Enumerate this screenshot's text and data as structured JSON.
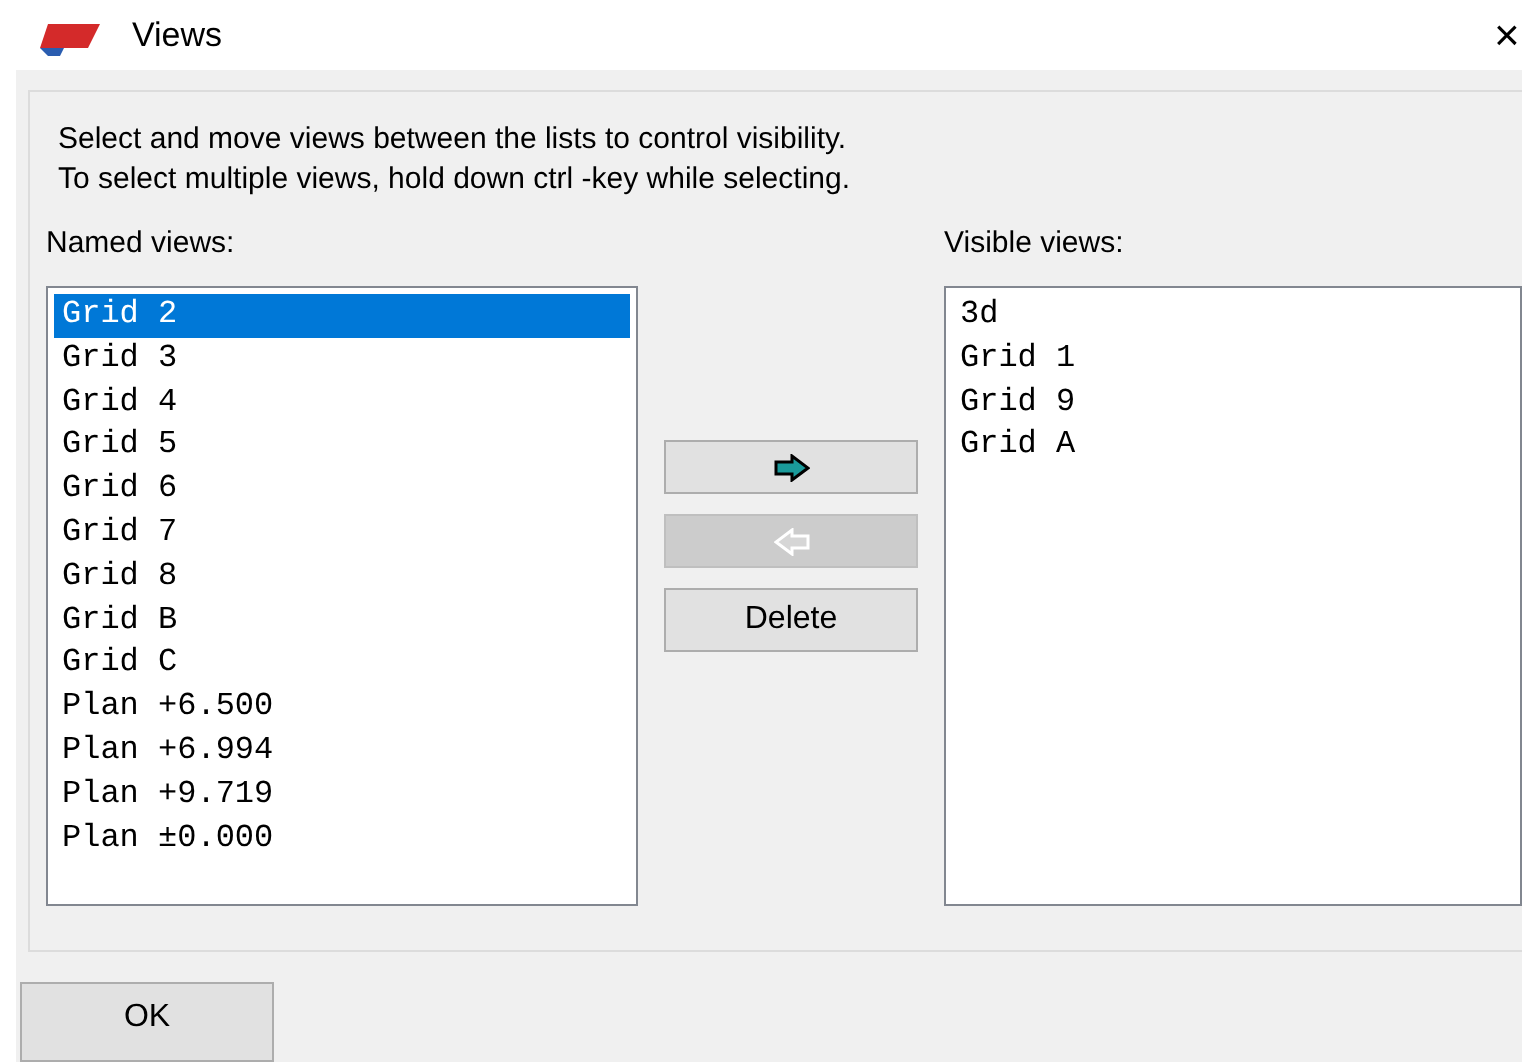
{
  "window": {
    "title": "Views",
    "close": "×"
  },
  "instructions": [
    "Select and move views between the lists to control visibility.",
    "To select multiple views, hold down ctrl -key while selecting."
  ],
  "named_views": {
    "label": "Named views:",
    "items": [
      {
        "label": "Grid 2",
        "selected": true
      },
      {
        "label": "Grid 3",
        "selected": false
      },
      {
        "label": "Grid 4",
        "selected": false
      },
      {
        "label": "Grid 5",
        "selected": false
      },
      {
        "label": "Grid 6",
        "selected": false
      },
      {
        "label": "Grid 7",
        "selected": false
      },
      {
        "label": "Grid 8",
        "selected": false
      },
      {
        "label": "Grid B",
        "selected": false
      },
      {
        "label": "Grid C",
        "selected": false
      },
      {
        "label": "Plan +6.500",
        "selected": false
      },
      {
        "label": "Plan +6.994",
        "selected": false
      },
      {
        "label": "Plan +9.719",
        "selected": false
      },
      {
        "label": "Plan ±0.000",
        "selected": false
      }
    ]
  },
  "move_buttons": [
    {
      "kind": "right",
      "disabled": false
    },
    {
      "kind": "left",
      "disabled": true
    }
  ],
  "delete_button": {
    "label": "Delete"
  },
  "visible_views": {
    "label": "Visible views:",
    "items": [
      {
        "label": "3d",
        "selected": false
      },
      {
        "label": "Grid 1",
        "selected": false
      },
      {
        "label": "Grid 9",
        "selected": false
      },
      {
        "label": "Grid A",
        "selected": false
      }
    ]
  },
  "ok_button": {
    "label": "OK"
  }
}
